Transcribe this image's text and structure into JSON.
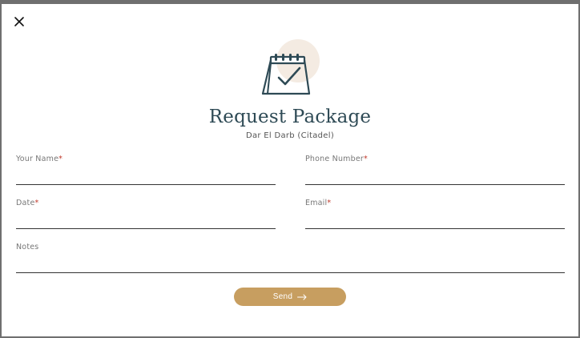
{
  "modal": {
    "title": "Request Package",
    "subtitle": "Dar El Darb (Citadel)"
  },
  "fields": {
    "name": {
      "label": "Your Name",
      "required": "*"
    },
    "phone": {
      "label": "Phone Number",
      "required": "*"
    },
    "date": {
      "label": "Date",
      "required": "*"
    },
    "email": {
      "label": "Email",
      "required": "*"
    },
    "notes": {
      "label": "Notes"
    }
  },
  "actions": {
    "send_label": "Send"
  },
  "icons": {
    "close": "close-icon",
    "calendar": "calendar-check-icon",
    "arrow": "arrow-right-icon"
  },
  "colors": {
    "title": "#2e4a55",
    "button": "#c79e60",
    "required": "#c0392b"
  }
}
